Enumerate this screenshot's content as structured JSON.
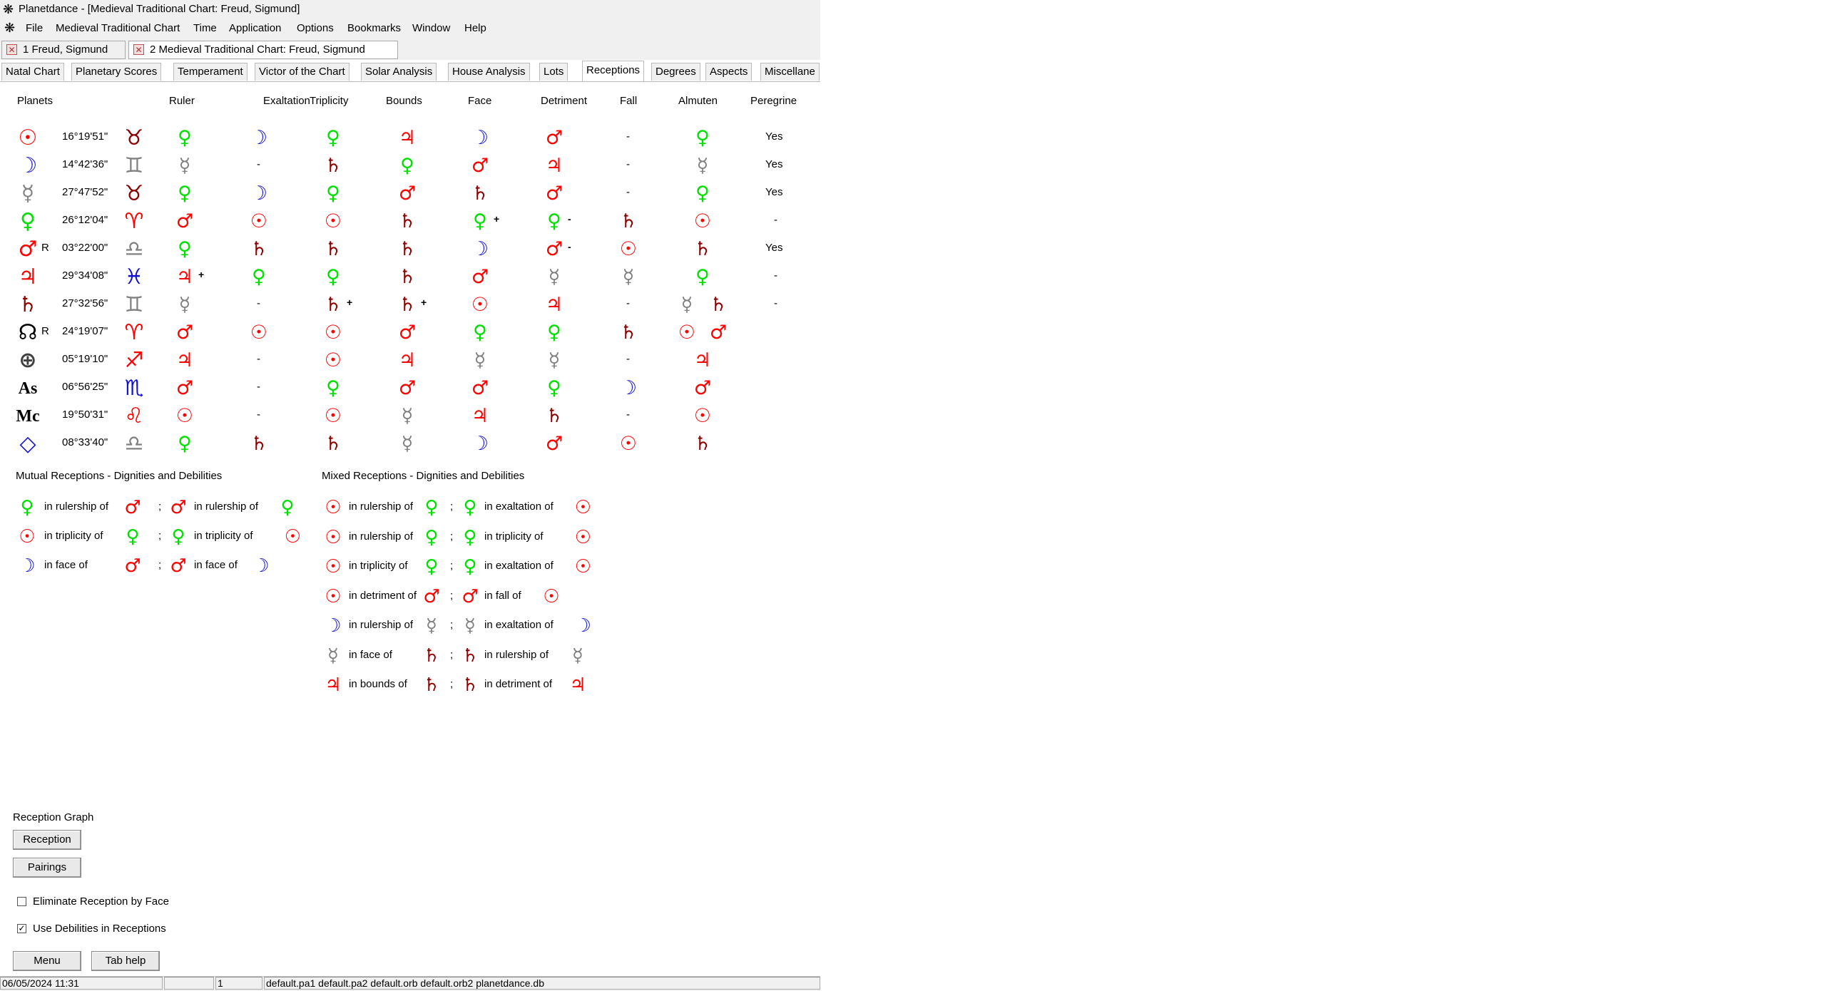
{
  "window": {
    "title": "Planetdance - [Medieval Traditional Chart:  Freud, Sigmund]"
  },
  "menu": [
    "File",
    "Medieval Traditional Chart",
    "Time",
    "Application",
    "Options",
    "Bookmarks",
    "Window",
    "Help"
  ],
  "doc_tabs": [
    {
      "label": "1 Freud, Sigmund",
      "active": false
    },
    {
      "label": "2 Medieval Traditional Chart:  Freud, Sigmund",
      "active": true
    }
  ],
  "feature_tabs": [
    "Natal Chart",
    "Planetary Scores",
    "Temperament",
    "Victor of the Chart",
    "Solar Analysis",
    "House Analysis",
    "Lots",
    "Receptions",
    "Degrees",
    "Aspects",
    "Miscellane"
  ],
  "active_feature_tab": "Receptions",
  "colors": {
    "venus": "#00e000",
    "moon": "#1010d0",
    "saturn": "#8b0000",
    "mars": "#ff0000",
    "mercury": "#808080",
    "sun": "#ff0000"
  },
  "table": {
    "headers": [
      "Planets",
      "Ruler",
      "Exaltation",
      "Triplicity",
      "Bounds",
      "Face",
      "Detriment",
      "Fall",
      "Almuten",
      "Peregrine"
    ],
    "rows": [
      {
        "planet": "sun",
        "degree": "16°19'51\"",
        "sign": "taurus",
        "ruler": "venus",
        "exaltation": "moon",
        "triplicity": "venus",
        "bounds": "jupiter",
        "face": "moon",
        "detriment": "mars",
        "fall": "-",
        "almuten": [
          "venus"
        ],
        "peregrine": "Yes"
      },
      {
        "planet": "moon",
        "degree": "14°42'36\"",
        "sign": "gemini",
        "ruler": "mercury",
        "exaltation": "-",
        "triplicity": "saturn",
        "bounds": "venus",
        "face": "mars",
        "detriment": "jupiter",
        "fall": "-",
        "almuten": [
          "mercury"
        ],
        "peregrine": "Yes"
      },
      {
        "planet": "mercury",
        "degree": "27°47'52\"",
        "sign": "taurus",
        "ruler": "venus",
        "exaltation": "moon",
        "triplicity": "venus",
        "bounds": "mars",
        "face": "saturn",
        "detriment": "mars",
        "fall": "-",
        "almuten": [
          "venus"
        ],
        "peregrine": "Yes"
      },
      {
        "planet": "venus",
        "degree": "26°12'04\"",
        "sign": "aries",
        "ruler": "mars",
        "exaltation": "sun",
        "triplicity": "sun",
        "bounds": "saturn",
        "face": "venus",
        "face_mark": "+",
        "detriment": "venus",
        "detriment_mark": "-",
        "fall": "saturn",
        "almuten": [
          "sun"
        ],
        "peregrine": "-"
      },
      {
        "planet": "mars",
        "retro": "R",
        "degree": "03°22'00\"",
        "sign": "libra",
        "ruler": "venus",
        "exaltation": "saturn",
        "triplicity": "saturn",
        "bounds": "saturn",
        "face": "moon",
        "detriment": "mars",
        "detriment_mark": "-",
        "fall": "sun",
        "almuten": [
          "saturn"
        ],
        "peregrine": "Yes"
      },
      {
        "planet": "jupiter",
        "degree": "29°34'08\"",
        "sign": "pisces",
        "ruler": "jupiter",
        "ruler_mark": "+",
        "exaltation": "venus",
        "triplicity": "venus",
        "bounds": "saturn",
        "face": "mars",
        "detriment": "mercury",
        "fall": "mercury",
        "almuten": [
          "venus"
        ],
        "peregrine": "-"
      },
      {
        "planet": "saturn",
        "degree": "27°32'56\"",
        "sign": "gemini",
        "ruler": "mercury",
        "exaltation": "-",
        "triplicity": "saturn",
        "triplicity_mark": "+",
        "bounds": "saturn",
        "bounds_mark": "+",
        "face": "sun",
        "detriment": "jupiter",
        "fall": "-",
        "almuten": [
          "mercury",
          "saturn"
        ],
        "peregrine": "-"
      },
      {
        "planet": "node",
        "retro": "R",
        "degree": "24°19'07\"",
        "sign": "aries",
        "ruler": "mars",
        "exaltation": "sun",
        "triplicity": "sun",
        "bounds": "mars",
        "face": "venus",
        "detriment": "venus",
        "fall": "saturn",
        "almuten": [
          "sun",
          "mars"
        ],
        "peregrine": ""
      },
      {
        "planet": "fortune",
        "degree": "05°19'10\"",
        "sign": "sagittarius",
        "ruler": "jupiter",
        "exaltation": "-",
        "triplicity": "sun",
        "bounds": "jupiter",
        "face": "mercury",
        "detriment": "mercury",
        "fall": "-",
        "almuten": [
          "jupiter"
        ],
        "peregrine": ""
      },
      {
        "planet": "asc",
        "degree": "06°56'25\"",
        "sign": "scorpio",
        "ruler": "mars",
        "exaltation": "-",
        "triplicity": "venus",
        "bounds": "mars",
        "face": "mars",
        "detriment": "venus",
        "fall": "moon",
        "almuten": [
          "mars"
        ],
        "peregrine": ""
      },
      {
        "planet": "mc",
        "degree": "19°50'31\"",
        "sign": "leo",
        "ruler": "sun",
        "exaltation": "-",
        "triplicity": "sun",
        "bounds": "mercury",
        "face": "jupiter",
        "detriment": "saturn",
        "fall": "-",
        "almuten": [
          "sun"
        ],
        "peregrine": ""
      },
      {
        "planet": "diamond",
        "degree": "08°33'40\"",
        "sign": "libra",
        "ruler": "venus",
        "exaltation": "saturn",
        "triplicity": "saturn",
        "bounds": "mercury",
        "face": "moon",
        "detriment": "mars",
        "fall": "sun",
        "almuten": [
          "saturn"
        ],
        "peregrine": ""
      }
    ]
  },
  "mutual": {
    "title": "Mutual Receptions - Dignities and Debilities",
    "lines": [
      {
        "a": "venus",
        "t1": "in rulership of",
        "b": "mars",
        "c": "mars",
        "t2": "in rulership of",
        "d": "venus"
      },
      {
        "a": "sun",
        "t1": "in triplicity of",
        "b": "venus",
        "c": "venus",
        "t2": "in triplicity of",
        "d": "sun"
      },
      {
        "a": "moon",
        "t1": "in face of",
        "b": "mars",
        "c": "mars",
        "t2": "in face of",
        "d": "moon"
      }
    ]
  },
  "mixed": {
    "title": "Mixed Receptions - Dignities and Debilities",
    "lines": [
      {
        "a": "sun",
        "t1": "in rulership of",
        "b": "venus",
        "c": "venus",
        "t2": "in exaltation of",
        "d": "sun"
      },
      {
        "a": "sun",
        "t1": "in rulership of",
        "b": "venus",
        "c": "venus",
        "t2": "in triplicity of",
        "d": "sun"
      },
      {
        "a": "sun",
        "t1": "in triplicity of",
        "b": "venus",
        "c": "venus",
        "t2": "in exaltation of",
        "d": "sun"
      },
      {
        "a": "sun",
        "t1": "in detriment of",
        "b": "mars",
        "c": "mars",
        "t2": "in fall of",
        "d": "sun"
      },
      {
        "a": "moon",
        "t1": "in rulership of",
        "b": "mercury",
        "c": "mercury",
        "t2": "in exaltation of",
        "d": "moon"
      },
      {
        "a": "mercury",
        "t1": "in face of",
        "b": "saturn",
        "c": "saturn",
        "t2": "in rulership of",
        "d": "mercury"
      },
      {
        "a": "jupiter",
        "t1": "in bounds of",
        "b": "saturn",
        "c": "saturn",
        "t2": "in detriment of",
        "d": "jupiter"
      }
    ]
  },
  "separator": ";",
  "reception_graph": {
    "title": "Reception Graph",
    "reception_button": "Reception",
    "pairings_button": "Pairings"
  },
  "options": {
    "eliminate_face": {
      "label": "Eliminate Reception by Face",
      "checked": false
    },
    "use_debilities": {
      "label": "Use Debilities in Receptions",
      "checked": true
    }
  },
  "buttons": {
    "menu": "Menu",
    "tab_help": "Tab help"
  },
  "status": {
    "datetime": "06/05/2024 11:31",
    "blank": "",
    "number": "1",
    "files": "default.pa1 default.pa2 default.orb default.orb2 planetdance.db"
  }
}
